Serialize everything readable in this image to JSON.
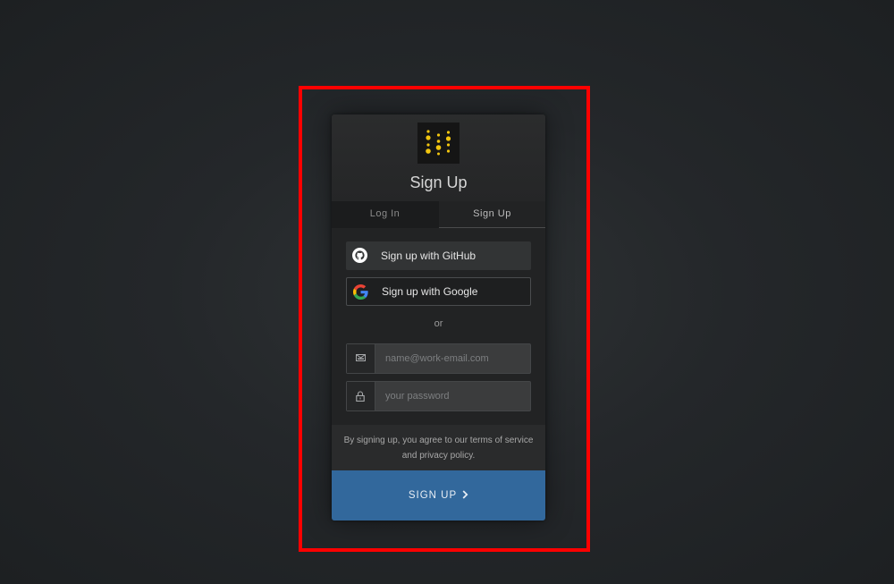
{
  "page": {
    "background": "#24272a",
    "highlight_color": "#ff0000"
  },
  "header": {
    "logo_icon": "dotted-m-logo",
    "logo_color": "#f2c50f",
    "title": "Sign Up"
  },
  "tabs": [
    {
      "label": "Log In",
      "active": false
    },
    {
      "label": "Sign Up",
      "active": true
    }
  ],
  "social": {
    "github": {
      "label": "Sign up with GitHub",
      "icon": "github-icon"
    },
    "google": {
      "label": "Sign up with Google",
      "icon": "google-icon"
    }
  },
  "separator": "or",
  "form": {
    "email": {
      "placeholder": "name@work-email.com",
      "value": "",
      "icon": "envelope-icon"
    },
    "password": {
      "placeholder": "your password",
      "value": "",
      "icon": "lock-icon"
    }
  },
  "terms_text": "By signing up, you agree to our terms of service and privacy policy.",
  "submit": {
    "label": "SIGN UP",
    "icon": "chevron-right-icon",
    "color": "#32689c"
  }
}
